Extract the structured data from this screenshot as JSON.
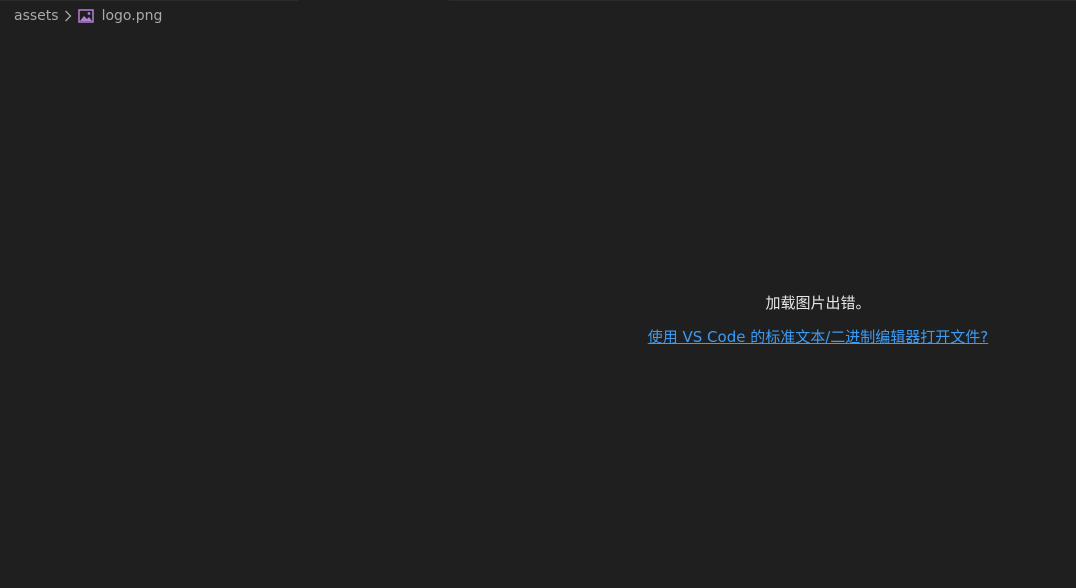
{
  "breadcrumb": {
    "folder": "assets",
    "file": "logo.png",
    "separator_icon": "chevron-right-icon",
    "file_icon": "image-file-icon"
  },
  "preview": {
    "error_message": "加载图片出错。",
    "open_with_link": "使用 VS Code 的标准文本/二进制编辑器打开文件?"
  },
  "colors": {
    "background": "#1f1f1f",
    "text": "#e6e6e6",
    "breadcrumb_text": "#a9a9a9",
    "link": "#3d9bf4",
    "image_icon": "#b180d7"
  }
}
